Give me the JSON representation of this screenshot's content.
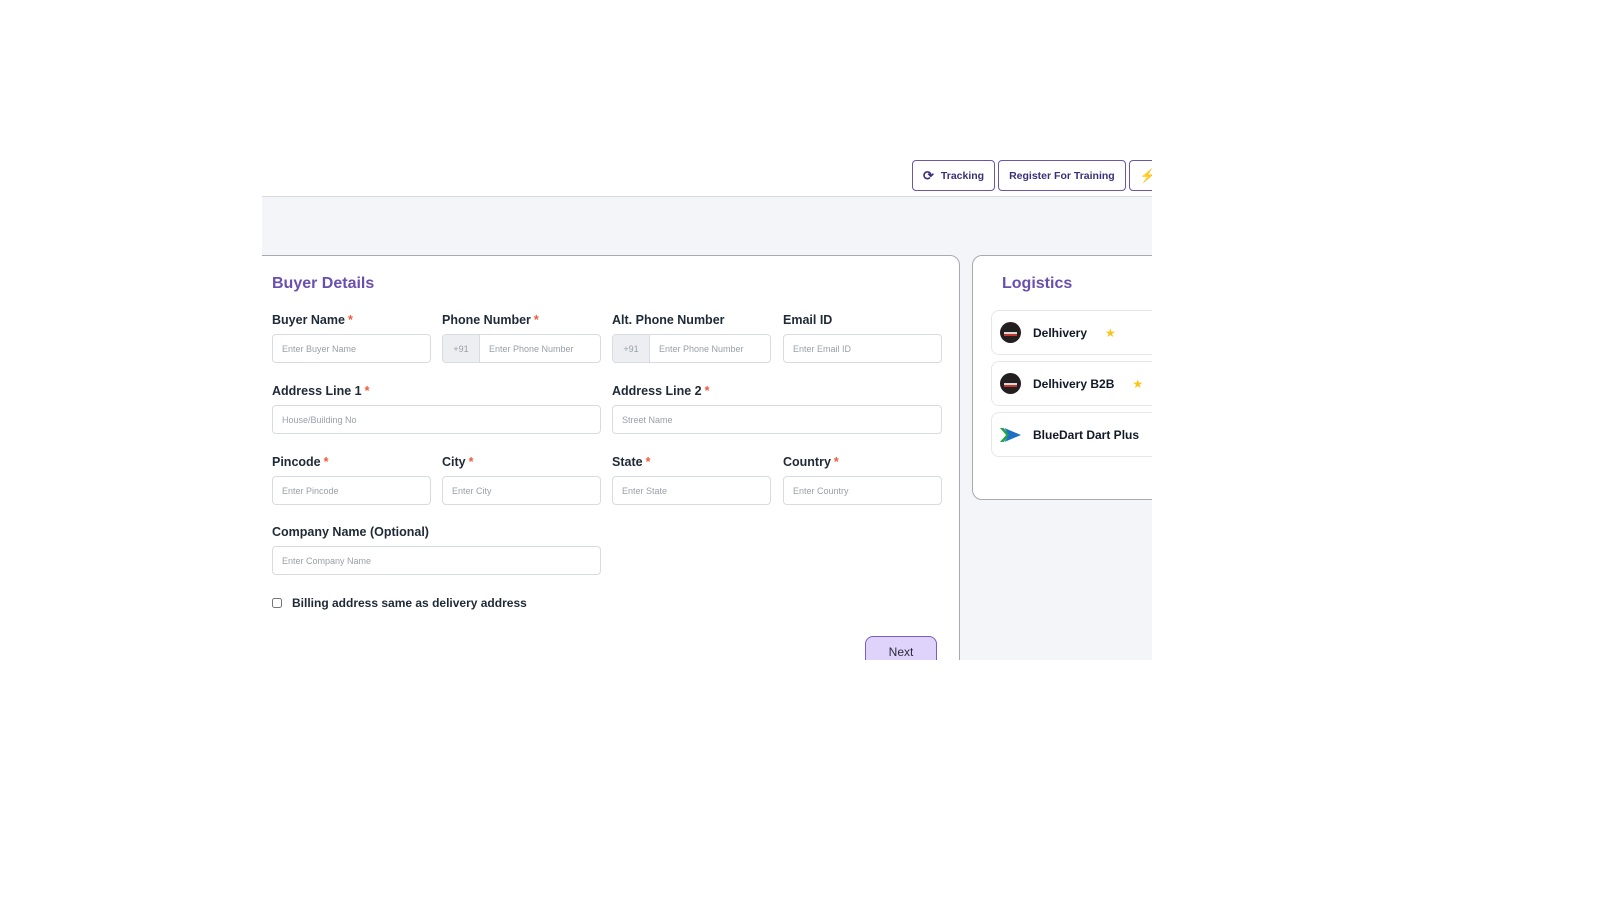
{
  "toolbar": {
    "buttons": [
      {
        "label": "Tracking",
        "icon": "refresh-icon",
        "glyph": "⟳"
      },
      {
        "label": "Register For Training"
      },
      {
        "label": "",
        "icon": "lightning-icon",
        "glyph": "⚡"
      }
    ]
  },
  "buyer_details": {
    "title": "Buyer Details",
    "required_mark": "*",
    "fields": {
      "buyer_name": {
        "label": "Buyer Name",
        "placeholder": "Enter Buyer Name",
        "value": ""
      },
      "phone_number": {
        "label": "Phone Number",
        "prefix": "+91",
        "placeholder": "Enter Phone Number",
        "value": ""
      },
      "alt_phone_number": {
        "label": "Alt. Phone Number",
        "prefix": "+91",
        "placeholder": "Enter Phone Number",
        "value": ""
      },
      "email_id": {
        "label": "Email ID",
        "placeholder": "Enter Email ID",
        "value": ""
      },
      "address_line_1": {
        "label": "Address Line 1",
        "placeholder": "House/Building No",
        "value": ""
      },
      "address_line_2": {
        "label": "Address Line 2",
        "placeholder": "Street Name",
        "value": ""
      },
      "pincode": {
        "label": "Pincode",
        "placeholder": "Enter Pincode",
        "value": ""
      },
      "city": {
        "label": "City",
        "placeholder": "Enter City",
        "value": ""
      },
      "state": {
        "label": "State",
        "placeholder": "Enter State",
        "value": ""
      },
      "country": {
        "label": "Country",
        "placeholder": "Enter Country",
        "value": ""
      },
      "company_name": {
        "label": "Company Name (Optional)",
        "placeholder": "Enter Company Name",
        "value": ""
      }
    },
    "billing_same": {
      "label": "Billing address same as delivery address",
      "checked": false
    },
    "next_label": "Next"
  },
  "logistics": {
    "title": "Logistics",
    "star_glyph": "★",
    "items": [
      {
        "name": "Delhivery",
        "logo": "delhivery-logo"
      },
      {
        "name": "Delhivery B2B",
        "logo": "delhivery-logo"
      },
      {
        "name": "BlueDart Dart Plus",
        "logo": "bluedart-logo"
      }
    ]
  },
  "colors": {
    "accent": "#6b4fae",
    "button_border": "#6b56a8",
    "next_bg": "#e0d3fb",
    "required": "#f05a3a",
    "star": "#f5c518"
  }
}
